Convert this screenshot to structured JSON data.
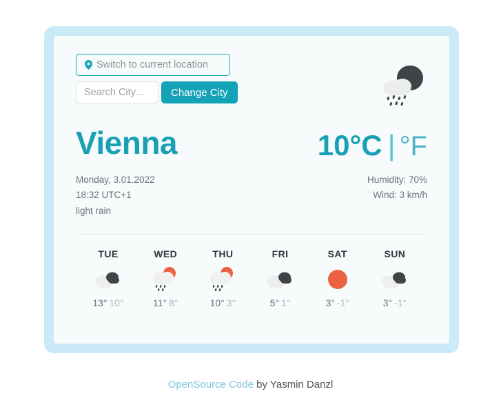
{
  "controls": {
    "location_button_label": "Switch to current location",
    "location_icon": "map-pin-icon",
    "search_placeholder": "Search City...",
    "search_value": "",
    "change_city_label": "Change City"
  },
  "hero": {
    "icon": "cloud-moon-rain-icon"
  },
  "current": {
    "city": "Vienna",
    "temperature": "10°C",
    "separator": "|",
    "alt_unit": "°F",
    "date": "Monday, 3.01.2022",
    "time": "18:32 UTC+1",
    "description": "light rain",
    "humidity": "Humidity: 70%",
    "wind": "Wind: 3 km/h"
  },
  "forecast": [
    {
      "day": "TUE",
      "icon": "cloudy-icon",
      "max": "13°",
      "min": "10°"
    },
    {
      "day": "WED",
      "icon": "sun-rain-icon",
      "max": "11°",
      "min": "8°"
    },
    {
      "day": "THU",
      "icon": "sun-rain-icon",
      "max": "10°",
      "min": "3°"
    },
    {
      "day": "FRI",
      "icon": "cloudy-icon",
      "max": "5°",
      "min": "1°"
    },
    {
      "day": "SAT",
      "icon": "sun-icon",
      "max": "3°",
      "min": "-1°"
    },
    {
      "day": "SUN",
      "icon": "cloudy-icon",
      "max": "3°",
      "min": "-1°"
    }
  ],
  "footer": {
    "link_text": "OpenSource Code",
    "rest_text": " by Yasmin Danzl"
  },
  "colors": {
    "accent_teal": "#19a0b4",
    "button_teal": "#14a2b8",
    "frame_blue": "#c9eaf6",
    "card_bg": "#f7fbfc",
    "sun_orange": "#ec6142",
    "cloud_dark": "#3f4447",
    "cloud_light": "#eeeeee"
  }
}
